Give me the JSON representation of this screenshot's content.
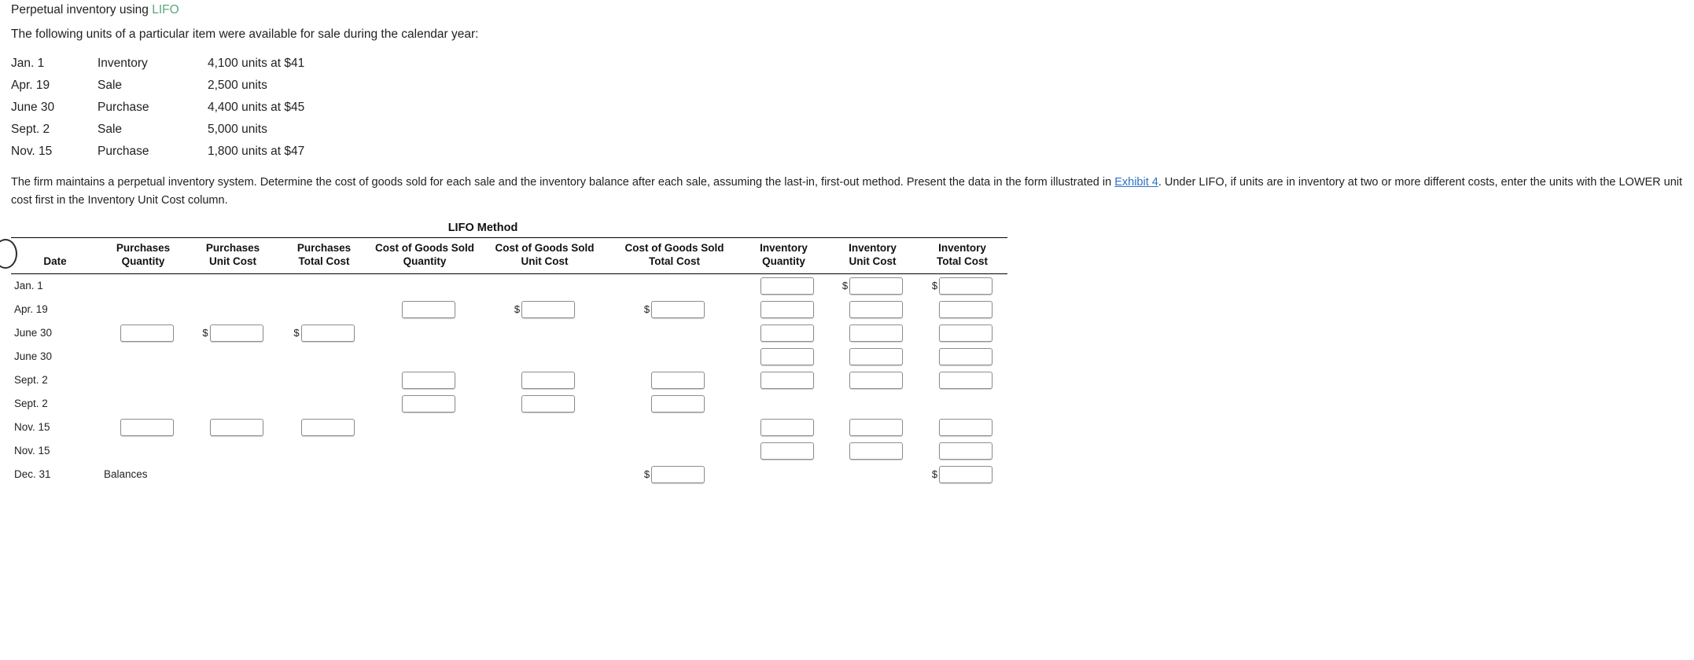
{
  "intro": {
    "title_prefix": "Perpetual inventory using ",
    "title_highlight": "LIFO",
    "lead": "The following units of a particular item were available for sale during the calendar year:",
    "highlight_color": "#5aa77d"
  },
  "availability": {
    "rows": [
      {
        "date": "Jan. 1",
        "kind": "Inventory",
        "desc": "4,100 units at $41"
      },
      {
        "date": "Apr. 19",
        "kind": "Sale",
        "desc": "2,500 units"
      },
      {
        "date": "June 30",
        "kind": "Purchase",
        "desc": "4,400 units at $45"
      },
      {
        "date": "Sept. 2",
        "kind": "Sale",
        "desc": "5,000 units"
      },
      {
        "date": "Nov. 15",
        "kind": "Purchase",
        "desc": "1,800 units at $47"
      }
    ]
  },
  "instructions": {
    "part1": "The firm maintains a perpetual inventory system. Determine the cost of goods sold for each sale and the inventory balance after each sale, assuming the last-in, first-out method. Present the data in the form illustrated in ",
    "link_text": "Exhibit 4",
    "link_color": "#2c72c7",
    "part2": ". Under LIFO, if units are in inventory at two or more different costs, enter the units with the LOWER unit cost first in the Inventory Unit Cost column."
  },
  "lifo_table": {
    "title": "LIFO Method",
    "columns": [
      {
        "top": "",
        "bottom": "Date"
      },
      {
        "top": "Purchases",
        "bottom": "Quantity"
      },
      {
        "top": "Purchases",
        "bottom": "Unit Cost"
      },
      {
        "top": "Purchases",
        "bottom": "Total Cost"
      },
      {
        "top": "Cost of Goods Sold",
        "bottom": "Quantity"
      },
      {
        "top": "Cost of Goods Sold",
        "bottom": "Unit Cost"
      },
      {
        "top": "Cost of Goods Sold",
        "bottom": "Total Cost"
      },
      {
        "top": "Inventory",
        "bottom": "Quantity"
      },
      {
        "top": "Inventory",
        "bottom": "Unit Cost"
      },
      {
        "top": "Inventory",
        "bottom": "Total Cost"
      }
    ],
    "rows": [
      {
        "date": "Jan. 1",
        "label": "",
        "cells": {
          "pq": {
            "input": false
          },
          "pu": {
            "input": false
          },
          "pt": {
            "input": false
          },
          "cq": {
            "input": false
          },
          "cu": {
            "input": false
          },
          "ct": {
            "input": false
          },
          "iq": {
            "input": true,
            "dollar": false,
            "value": ""
          },
          "iu": {
            "input": true,
            "dollar": true,
            "value": ""
          },
          "it": {
            "input": true,
            "dollar": true,
            "value": ""
          }
        }
      },
      {
        "date": "Apr. 19",
        "label": "",
        "cells": {
          "pq": {
            "input": false
          },
          "pu": {
            "input": false
          },
          "pt": {
            "input": false
          },
          "cq": {
            "input": true,
            "dollar": false,
            "value": ""
          },
          "cu": {
            "input": true,
            "dollar": true,
            "value": ""
          },
          "ct": {
            "input": true,
            "dollar": true,
            "value": ""
          },
          "iq": {
            "input": true,
            "dollar": false,
            "value": ""
          },
          "iu": {
            "input": true,
            "dollar": false,
            "value": ""
          },
          "it": {
            "input": true,
            "dollar": false,
            "value": ""
          }
        }
      },
      {
        "date": "June 30",
        "label": "",
        "cells": {
          "pq": {
            "input": true,
            "dollar": false,
            "value": ""
          },
          "pu": {
            "input": true,
            "dollar": true,
            "value": ""
          },
          "pt": {
            "input": true,
            "dollar": true,
            "value": ""
          },
          "cq": {
            "input": false
          },
          "cu": {
            "input": false
          },
          "ct": {
            "input": false
          },
          "iq": {
            "input": true,
            "dollar": false,
            "value": ""
          },
          "iu": {
            "input": true,
            "dollar": false,
            "value": ""
          },
          "it": {
            "input": true,
            "dollar": false,
            "value": ""
          }
        }
      },
      {
        "date": "June 30",
        "label": "",
        "cells": {
          "pq": {
            "input": false
          },
          "pu": {
            "input": false
          },
          "pt": {
            "input": false
          },
          "cq": {
            "input": false
          },
          "cu": {
            "input": false
          },
          "ct": {
            "input": false
          },
          "iq": {
            "input": true,
            "dollar": false,
            "value": ""
          },
          "iu": {
            "input": true,
            "dollar": false,
            "value": ""
          },
          "it": {
            "input": true,
            "dollar": false,
            "value": ""
          }
        }
      },
      {
        "date": "Sept. 2",
        "label": "",
        "cells": {
          "pq": {
            "input": false
          },
          "pu": {
            "input": false
          },
          "pt": {
            "input": false
          },
          "cq": {
            "input": true,
            "dollar": false,
            "value": ""
          },
          "cu": {
            "input": true,
            "dollar": false,
            "value": ""
          },
          "ct": {
            "input": true,
            "dollar": false,
            "value": ""
          },
          "iq": {
            "input": true,
            "dollar": false,
            "value": ""
          },
          "iu": {
            "input": true,
            "dollar": false,
            "value": ""
          },
          "it": {
            "input": true,
            "dollar": false,
            "value": ""
          }
        }
      },
      {
        "date": "Sept. 2",
        "label": "",
        "cells": {
          "pq": {
            "input": false
          },
          "pu": {
            "input": false
          },
          "pt": {
            "input": false
          },
          "cq": {
            "input": true,
            "dollar": false,
            "value": ""
          },
          "cu": {
            "input": true,
            "dollar": false,
            "value": ""
          },
          "ct": {
            "input": true,
            "dollar": false,
            "value": ""
          },
          "iq": {
            "input": false
          },
          "iu": {
            "input": false
          },
          "it": {
            "input": false
          }
        }
      },
      {
        "date": "Nov. 15",
        "label": "",
        "cells": {
          "pq": {
            "input": true,
            "dollar": false,
            "value": ""
          },
          "pu": {
            "input": true,
            "dollar": false,
            "value": ""
          },
          "pt": {
            "input": true,
            "dollar": false,
            "value": ""
          },
          "cq": {
            "input": false
          },
          "cu": {
            "input": false
          },
          "ct": {
            "input": false
          },
          "iq": {
            "input": true,
            "dollar": false,
            "value": ""
          },
          "iu": {
            "input": true,
            "dollar": false,
            "value": ""
          },
          "it": {
            "input": true,
            "dollar": false,
            "value": ""
          }
        }
      },
      {
        "date": "Nov. 15",
        "label": "",
        "cells": {
          "pq": {
            "input": false
          },
          "pu": {
            "input": false
          },
          "pt": {
            "input": false
          },
          "cq": {
            "input": false
          },
          "cu": {
            "input": false
          },
          "ct": {
            "input": false
          },
          "iq": {
            "input": true,
            "dollar": false,
            "value": ""
          },
          "iu": {
            "input": true,
            "dollar": false,
            "value": ""
          },
          "it": {
            "input": true,
            "dollar": false,
            "value": ""
          }
        }
      },
      {
        "date": "Dec. 31",
        "label": "Balances",
        "cells": {
          "pq": {
            "input": false
          },
          "pu": {
            "input": false
          },
          "pt": {
            "input": false
          },
          "cq": {
            "input": false
          },
          "cu": {
            "input": false
          },
          "ct": {
            "input": true,
            "dollar": true,
            "value": ""
          },
          "iq": {
            "input": false
          },
          "iu": {
            "input": false
          },
          "it": {
            "input": true,
            "dollar": true,
            "value": ""
          }
        }
      }
    ]
  }
}
